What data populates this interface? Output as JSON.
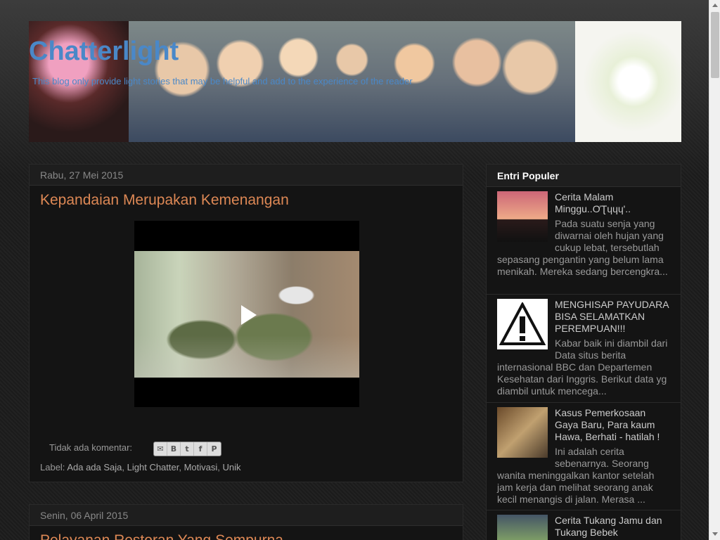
{
  "header": {
    "title": "Chatterlight",
    "description": "This blog only provide light stories that may be helpful and add to the experience of the reader"
  },
  "posts": [
    {
      "date": "Rabu, 27 Mei 2015",
      "title": "Kepandaian Merupakan Kemenangan",
      "comments": "Tidak ada komentar:",
      "label_prefix": "Label:",
      "labels": [
        "Ada ada Saja",
        "Light Chatter",
        "Motivasi",
        "Unik"
      ]
    },
    {
      "date": "Senin, 06 April 2015",
      "title": "Pelayanan Restoran Yang Sempurna"
    }
  ],
  "share_icons": [
    "email-icon",
    "blogger-icon",
    "twitter-icon",
    "facebook-icon",
    "pinterest-icon"
  ],
  "sidebar": {
    "widget_title": "Entri Populer",
    "items": [
      {
        "title": "Cerita Malam Minggu..ƠƮɥɥɥ'..",
        "snippet": "Pada suatu senja yang diwarnai oleh hujan yang cukup lebat, tersebutlah sepasang pengantin yang belum lama menikah. Mereka sedang bercengkra..."
      },
      {
        "title": "MENGHISAP PAYUDARA BISA SELAMATKAN PEREMPUAN!!!",
        "snippet": "Kabar baik ini diambil dari Data situs berita internasional BBC dan Departemen Kesehatan dari Inggris. Berikut data yg diambil untuk mencega..."
      },
      {
        "title": "Kasus Pemerkosaan Gaya Baru, Para kaum Hawa, Berhati - hatilah !",
        "snippet": "Ini adalah cerita sebenarnya. Seorang wanita meninggalkan kantor setelah jam kerja dan melihat seorang anak kecil menangis di jalan. Merasa ..."
      },
      {
        "title": "Cerita Tukang Jamu dan Tukang Bebek",
        "snippet": ""
      }
    ]
  },
  "colors": {
    "title_blue": "#4a88c8",
    "post_title_orange": "#dd8855",
    "background": "#1b1b1b"
  }
}
